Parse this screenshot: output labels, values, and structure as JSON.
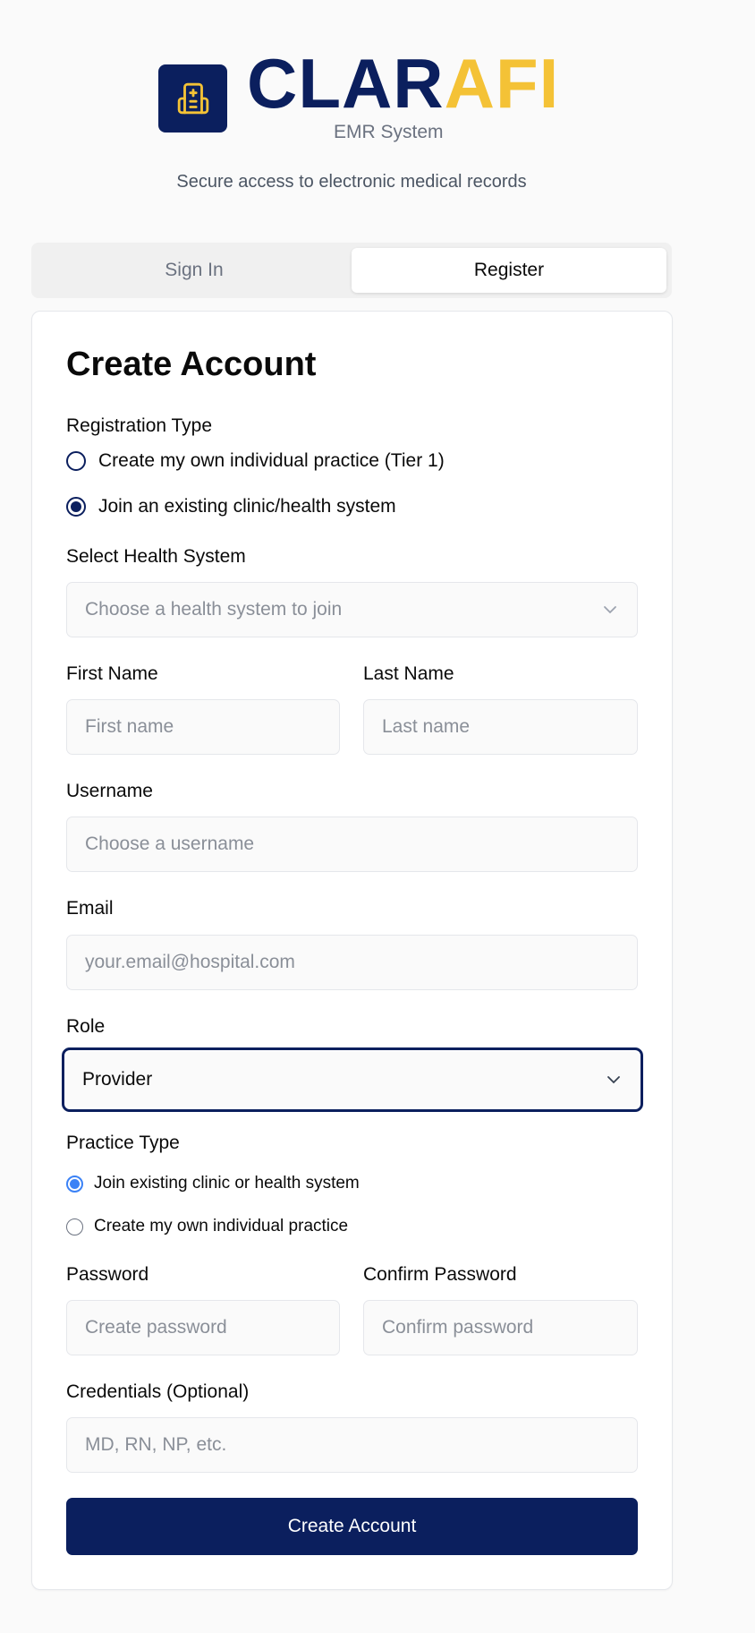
{
  "brand": {
    "name_part1": "CLAR",
    "name_part2": "AFI",
    "subtitle": "EMR System",
    "tagline": "Secure access to electronic medical records",
    "icon": "hospital-icon",
    "colors": {
      "navy": "#0b1f5e",
      "gold": "#f4c236"
    }
  },
  "tabs": [
    {
      "label": "Sign In",
      "active": false
    },
    {
      "label": "Register",
      "active": true
    }
  ],
  "form": {
    "title": "Create Account",
    "registration_type": {
      "label": "Registration Type",
      "options": [
        {
          "label": "Create my own individual practice (Tier 1)",
          "checked": false
        },
        {
          "label": "Join an existing clinic/health system",
          "checked": true
        }
      ]
    },
    "health_system": {
      "label": "Select Health System",
      "placeholder": "Choose a health system to join"
    },
    "first_name": {
      "label": "First Name",
      "placeholder": "First name"
    },
    "last_name": {
      "label": "Last Name",
      "placeholder": "Last name"
    },
    "username": {
      "label": "Username",
      "placeholder": "Choose a username"
    },
    "email": {
      "label": "Email",
      "placeholder": "your.email@hospital.com"
    },
    "role": {
      "label": "Role",
      "value": "Provider"
    },
    "practice_type": {
      "label": "Practice Type",
      "options": [
        {
          "label": "Join existing clinic or health system",
          "checked": true
        },
        {
          "label": "Create my own individual practice",
          "checked": false
        }
      ]
    },
    "password": {
      "label": "Password",
      "placeholder": "Create password"
    },
    "confirm_password": {
      "label": "Confirm Password",
      "placeholder": "Confirm password"
    },
    "credentials": {
      "label": "Credentials (Optional)",
      "placeholder": "MD, RN, NP, etc."
    },
    "submit_label": "Create Account"
  }
}
